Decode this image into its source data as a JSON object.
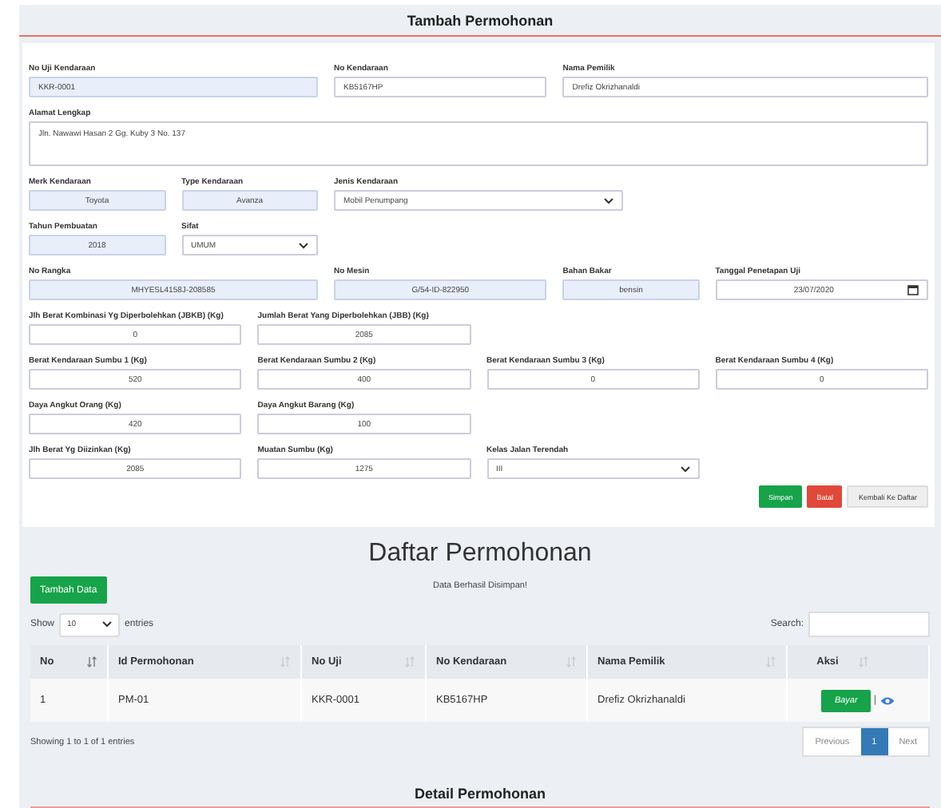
{
  "form": {
    "title": "Tambah Permohonan",
    "rows": [
      [
        {
          "label": "No Uji Kendaraan",
          "kind": "text",
          "value": "KKR-0001",
          "readonly": true
        },
        {
          "label": "No Kendaraan",
          "kind": "text",
          "value": "KB5167HP",
          "readonly": false
        },
        {
          "label": "Nama Pemilik",
          "kind": "text",
          "value": "Drefiz Okrizhanaldi",
          "readonly": false
        }
      ],
      [
        {
          "label": "Alamat Lengkap",
          "kind": "textarea",
          "value": "Jln. Nawawi Hasan 2 Gg. Kuby 3 No. 137",
          "readonly": false
        }
      ],
      [
        {
          "label": "Merk Kendaraan",
          "kind": "centered",
          "value": "Toyota",
          "readonly": true
        },
        {
          "label": "Type Kendaraan",
          "kind": "centered",
          "value": "Avanza",
          "readonly": true
        },
        {
          "label": "Jenis Kendaraan",
          "kind": "select",
          "value": "Mobil Penumpang",
          "readonly": false
        }
      ],
      [
        {
          "label": "Tahun Pembuatan",
          "kind": "centered",
          "value": "2018",
          "readonly": true
        },
        {
          "label": "Sifat",
          "kind": "select",
          "value": "UMUM",
          "readonly": false
        }
      ],
      [
        {
          "label": "No Rangka",
          "kind": "centered",
          "value": "MHYESL4158J-208585",
          "readonly": true
        },
        {
          "label": "No Mesin",
          "kind": "centered",
          "value": "G/54-ID-822950",
          "readonly": true
        },
        {
          "label": "Bahan Bakar",
          "kind": "centered",
          "value": "bensin",
          "readonly": true
        },
        {
          "label": "Tanggal Penetapan Uji",
          "kind": "date",
          "value": "23/07/2020",
          "readonly": false
        }
      ],
      [
        {
          "label": "Jlh Berat Kombinasi Yg Diperbolehkan (JBKB) (Kg)",
          "kind": "centered",
          "value": "0",
          "readonly": false
        },
        {
          "label": "Jumlah Berat Yang Diperbolehkan (JBB) (Kg)",
          "kind": "centered",
          "value": "2085",
          "readonly": false
        }
      ],
      [
        {
          "label": "Berat Kendaraan Sumbu 1 (Kg)",
          "kind": "centered",
          "value": "520",
          "readonly": false
        },
        {
          "label": "Berat Kendaraan Sumbu 2 (Kg)",
          "kind": "centered",
          "value": "400",
          "readonly": false
        },
        {
          "label": "Berat Kendaraan Sumbu 3 (Kg)",
          "kind": "centered",
          "value": "0",
          "readonly": false
        },
        {
          "label": "Berat Kendaraan Sumbu 4 (Kg)",
          "kind": "centered",
          "value": "0",
          "readonly": false
        }
      ],
      [
        {
          "label": "Daya Angkut Orang (Kg)",
          "kind": "centered",
          "value": "420",
          "readonly": false
        },
        {
          "label": "Daya Angkut Barang (Kg)",
          "kind": "centered",
          "value": "100",
          "readonly": false
        }
      ],
      [
        {
          "label": "Jlh Berat Yg Diizinkan (Kg)",
          "kind": "centered",
          "value": "2085",
          "readonly": false
        },
        {
          "label": "Muatan Sumbu (Kg)",
          "kind": "centered",
          "value": "1275",
          "readonly": false
        },
        {
          "label": "Kelas Jalan Terendah",
          "kind": "select",
          "value": "III",
          "readonly": false
        }
      ]
    ],
    "buttons": [
      {
        "label": "Simpan",
        "kind": "success"
      },
      {
        "label": "Batal",
        "kind": "danger"
      },
      {
        "label": "Kembali Ke Daftar",
        "kind": "default"
      }
    ]
  },
  "list": {
    "title": "Daftar Permohonan",
    "add_button": "Tambah Data",
    "message": "Data Berhasil Disimpan!",
    "length": {
      "before": "Show",
      "value": "10",
      "after": "entries"
    },
    "search": {
      "label": "Search:"
    },
    "table": {
      "columns": [
        {
          "label": "No",
          "sorted": true
        },
        {
          "label": "Id Permohonan",
          "sorted": false
        },
        {
          "label": "No Uji",
          "sorted": false
        },
        {
          "label": "No Kendaraan",
          "sorted": false
        },
        {
          "label": "Nama Pemilik",
          "sorted": false
        },
        {
          "label": "Aksi",
          "sorted": false
        }
      ],
      "rows": [
        {
          "cells": [
            "1",
            "PM-01",
            "KKR-0001",
            "KB5167HP",
            "Drefiz Okrizhanaldi"
          ],
          "action": "Bayar",
          "separator": "|"
        }
      ]
    },
    "info": "Showing 1 to 1 of 1 entries",
    "pagination": [
      {
        "label": "Previous",
        "selected": false
      },
      {
        "label": "1",
        "selected": true
      },
      {
        "label": "Next",
        "selected": false
      }
    ]
  },
  "detail": {
    "title": "Detail Permohonan"
  }
}
